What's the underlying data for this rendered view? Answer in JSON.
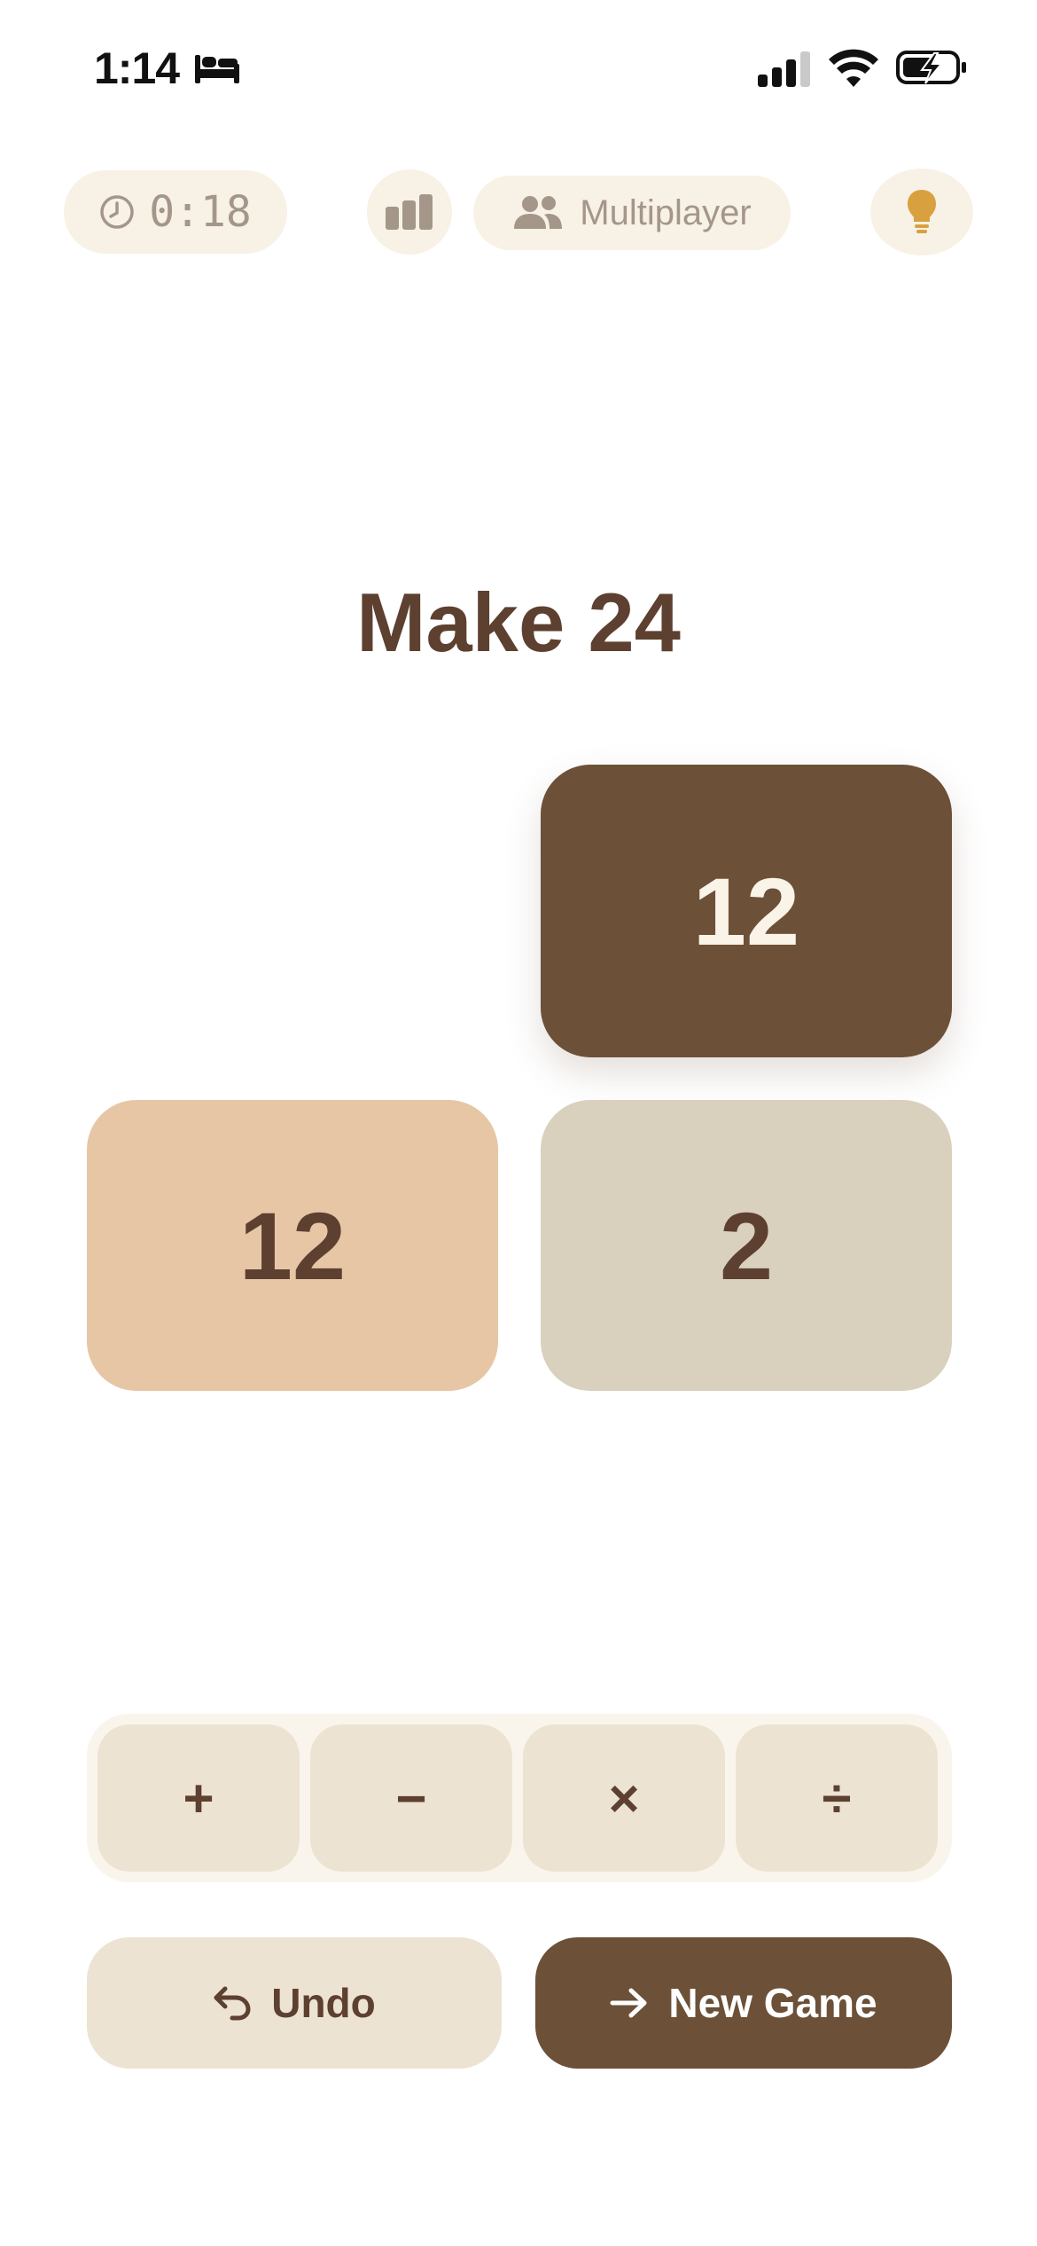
{
  "status_bar": {
    "time": "1:14",
    "icons": [
      "bed-icon",
      "signal-icon",
      "wifi-icon",
      "battery-charging-icon"
    ]
  },
  "top_bar": {
    "timer": "0:18",
    "multiplayer_label": "Multiplayer",
    "icons": [
      "clock-icon",
      "bar-chart-icon",
      "people-icon",
      "lightbulb-icon"
    ]
  },
  "game": {
    "title": "Make 24",
    "cards": [
      {
        "value": "12",
        "style": "selected-dark",
        "color": "#6C5038"
      },
      {
        "value": "12",
        "style": "peach",
        "color": "#E6C6A5"
      },
      {
        "value": "2",
        "style": "gray",
        "color": "#D9D0BE"
      }
    ]
  },
  "operators": {
    "add": "+",
    "subtract": "−",
    "multiply": "×",
    "divide": "÷"
  },
  "actions": {
    "undo_label": "Undo",
    "new_game_label": "New Game"
  },
  "colors": {
    "brown": "#5D4030",
    "dark_card": "#6C5038",
    "pill_bg": "#F8F1E6",
    "button_bg": "#EDE3D2",
    "hint": "#D9A040"
  }
}
